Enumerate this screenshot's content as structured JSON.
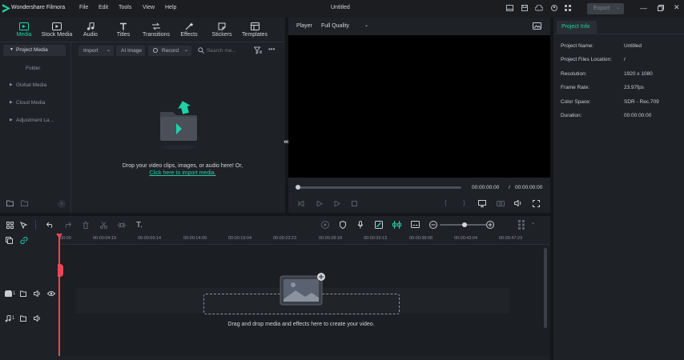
{
  "app": {
    "name": "Wondershare Filmora",
    "menu": [
      "File",
      "Edit",
      "Tools",
      "View",
      "Help"
    ],
    "project_title": "Untitled",
    "export_label": "Export",
    "accent": "#1fd1a5"
  },
  "toolbar": {
    "tabs": [
      {
        "label": "Media",
        "icon": "media-icon"
      },
      {
        "label": "Stock Media",
        "icon": "stock-media-icon"
      },
      {
        "label": "Audio",
        "icon": "music-note-icon"
      },
      {
        "label": "Titles",
        "icon": "text-icon"
      },
      {
        "label": "Transitions",
        "icon": "transitions-icon"
      },
      {
        "label": "Effects",
        "icon": "effects-icon"
      },
      {
        "label": "Stickers",
        "icon": "stickers-icon"
      },
      {
        "label": "Templates",
        "icon": "templates-icon"
      }
    ]
  },
  "media": {
    "nav": {
      "project_media": "Project Media",
      "folder": "Folder",
      "global_media": "Global Media",
      "cloud_media": "Cloud Media",
      "adjustment_layer": "Adjustment La..."
    },
    "import_label": "Import",
    "ai_image_label": "AI Image",
    "record_label": "Record",
    "search_placeholder": "Search me...",
    "drop_text": "Drop your video clips, images, or audio here! Or,",
    "import_link": "Click here to import media."
  },
  "player": {
    "label": "Player",
    "quality": "Full Quality",
    "current_time": "00:00:00:00",
    "separator": "/",
    "total_time": "00:00:00:00"
  },
  "project_info": {
    "tab_label": "Project Info",
    "rows": [
      {
        "label": "Project Name:",
        "value": "Untitled"
      },
      {
        "label": "Project Files Location:",
        "value": "/"
      },
      {
        "label": "Resolution:",
        "value": "1920 x 1080"
      },
      {
        "label": "Frame Rate:",
        "value": "23.97fps"
      },
      {
        "label": "Color Space:",
        "value": "SDR - Rec.709"
      },
      {
        "label": "Duration:",
        "value": "00:00:00:00"
      }
    ]
  },
  "timeline": {
    "ticks": [
      "00:00",
      "00:00:04:19",
      "00:00:09:14",
      "00:00:14:09",
      "00:00:19:04",
      "00:00:23:23",
      "00:00:28:18",
      "00:00:33:13",
      "00:00:38:08",
      "00:00:43:04",
      "00:00:47:23"
    ],
    "video_track_num": "1",
    "audio_track_num": "1",
    "drop_hint": "Drag and drop media and effects here to create your video.",
    "playhead_color": "#e84855"
  }
}
